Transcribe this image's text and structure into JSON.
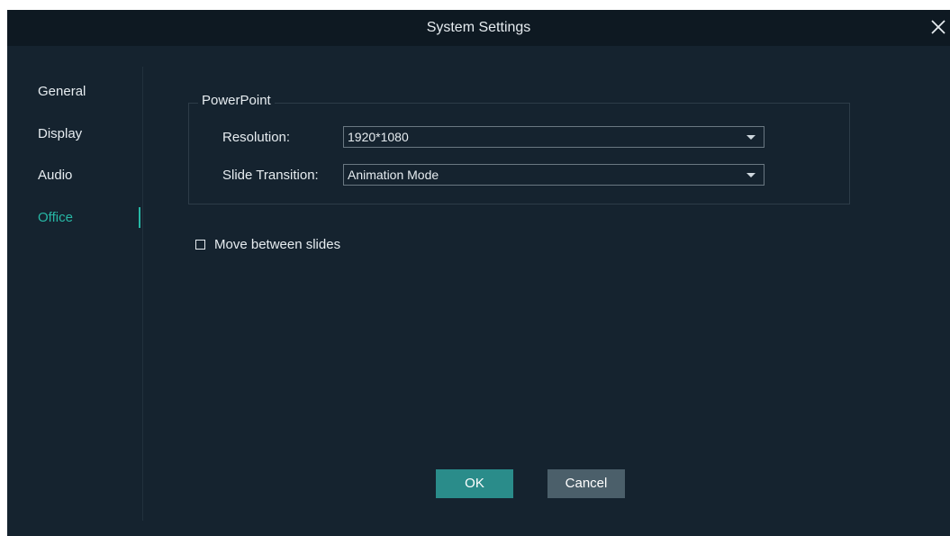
{
  "window": {
    "title": "System Settings",
    "close_icon": "close-icon"
  },
  "sidebar": {
    "items": [
      {
        "label": "General",
        "active": false
      },
      {
        "label": "Display",
        "active": false
      },
      {
        "label": "Audio",
        "active": false
      },
      {
        "label": "Office",
        "active": true
      }
    ]
  },
  "powerpoint": {
    "group_title": "PowerPoint",
    "resolution": {
      "label": "Resolution:",
      "value": "1920*1080"
    },
    "slide_transition": {
      "label": "Slide Transition:",
      "value": "Animation Mode"
    }
  },
  "options": {
    "move_between_slides": {
      "label": "Move between slides",
      "checked": false
    }
  },
  "buttons": {
    "ok_label": "OK",
    "cancel_label": "Cancel"
  },
  "colors": {
    "background": "#15232f",
    "titlebar": "#0e1922",
    "accent": "#27b7a5",
    "ok_button": "#2a8c8a",
    "cancel_button": "#4b5f6a"
  }
}
